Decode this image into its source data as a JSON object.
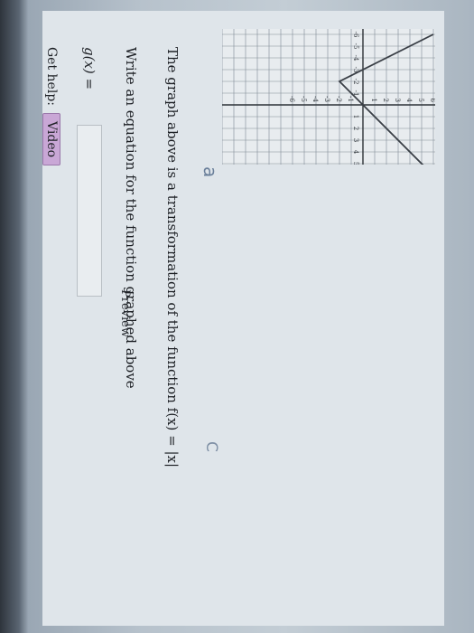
{
  "graph": {
    "x_ticks": [
      "-6",
      "-5",
      "-4",
      "-3",
      "-2",
      "-1",
      "1",
      "2",
      "3",
      "4",
      "5",
      "6"
    ],
    "y_ticks": [
      "6",
      "5",
      "4",
      "3",
      "2",
      "1",
      "-1",
      "-2",
      "-3",
      "-4",
      "-5",
      "-6"
    ],
    "function": "f(x) = |x| transformed",
    "vertex": [
      -2,
      -2
    ],
    "line_color": "#3a3f46"
  },
  "question": {
    "line1": "The graph above is a transformation of the function f(x) = |x|",
    "line2": "Write an equation for the function graphed above"
  },
  "answer": {
    "label": "g(x) =",
    "value": "",
    "preview_label": "Preview"
  },
  "help": {
    "label": "Get help:",
    "video_label": "Video"
  },
  "marks": {
    "a": "a",
    "c": "C"
  }
}
